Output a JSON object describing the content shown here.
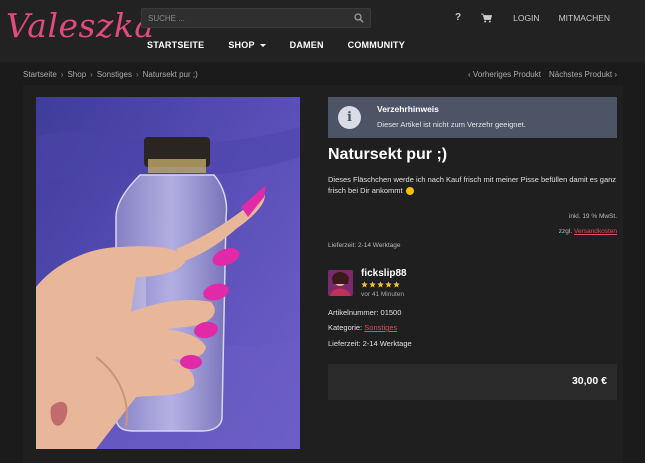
{
  "header": {
    "logo": "Valeszka",
    "search_placeholder": "SUCHE ...",
    "nav": [
      "STARTSEITE",
      "SHOP",
      "DAMEN",
      "COMMUNITY"
    ],
    "help": "?",
    "login": "LOGIN",
    "join": "MITMACHEN"
  },
  "breadcrumb": {
    "items": [
      "Startseite",
      "Shop",
      "Sonstiges",
      "Natursekt pur ;)"
    ],
    "prev": "Vorheriges Produkt",
    "next": "Nächstes Produkt"
  },
  "notice": {
    "title": "Verzehrhinweis",
    "text": "Dieser Artikel ist nicht zum Verzehr geeignet."
  },
  "product": {
    "title": "Natursekt pur ;)",
    "description": "Dieses Fläschchen werde ich nach Kauf frisch mit meiner Pisse befüllen damit es ganz frisch bei Dir ankommt",
    "tax": "inkl. 19 % MwSt.",
    "shipping_prefix": "zzgl.",
    "shipping_link": "Versandkosten",
    "delivery_top": "Lieferzeit: 2-14 Werktage",
    "seller": {
      "name": "fickslip88",
      "rating": 5,
      "time": "vor 41 Minuten"
    },
    "article_label": "Artikelnummer:",
    "article_number": "01500",
    "category_label": "Kategorie:",
    "category": "Sonstiges",
    "delivery_label": "Lieferzeit:",
    "delivery": "2-14 Werktage",
    "price": "30,00 €"
  },
  "colors": {
    "accent": "#e04a5f",
    "logo": "#e04a7d",
    "notice_bg": "#4c5466",
    "star": "#f0c23a"
  }
}
